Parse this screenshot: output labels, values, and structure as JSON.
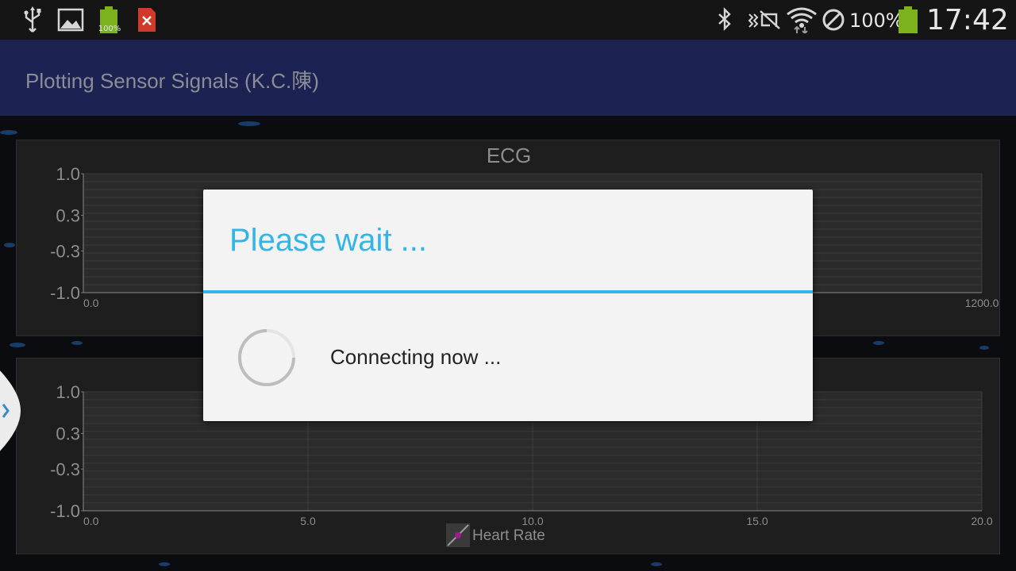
{
  "status_bar": {
    "icons_left": [
      "usb-icon",
      "image-icon",
      "battery-icon",
      "error-file-icon"
    ],
    "small_battery_label": "100%",
    "icons_right": [
      "bluetooth-icon",
      "nfc-mute-icon",
      "wifi-icon",
      "block-icon"
    ],
    "battery_percent": "100%",
    "clock": "17:42"
  },
  "action_bar": {
    "title": "Plotting Sensor Signals (K.C.陳)"
  },
  "charts": {
    "ecg": {
      "title": "ECG",
      "y_ticks": [
        "1.0",
        "0.3",
        "-0.3",
        "-1.0"
      ],
      "x_ticks": [
        "0.0",
        "1200.0"
      ]
    },
    "heart_rate": {
      "y_ticks": [
        "1.0",
        "0.3",
        "-0.3",
        "-1.0"
      ],
      "x_ticks": [
        "0.0",
        "5.0",
        "10.0",
        "15.0",
        "20.0"
      ],
      "legend_label": "Heart Rate",
      "legend_color": "#9b1d8f"
    }
  },
  "dialog": {
    "title": "Please wait ...",
    "message": "Connecting now ..."
  },
  "colors": {
    "accent": "#33b5e5",
    "action_bar": "#1c2352",
    "status_battery": "#7cb21d",
    "status_error": "#d03a2a"
  },
  "chart_data": [
    {
      "type": "line",
      "title": "ECG",
      "y_ticks": [
        1.0,
        0.3,
        -0.3,
        -1.0
      ],
      "ylim": [
        -1.0,
        1.0
      ],
      "x_ticks": [
        0.0,
        1200.0
      ],
      "xlim": [
        0.0,
        1200.0
      ],
      "grid": true,
      "series": []
    },
    {
      "type": "line",
      "title": "",
      "y_ticks": [
        1.0,
        0.3,
        -0.3,
        -1.0
      ],
      "ylim": [
        -1.0,
        1.0
      ],
      "x_ticks": [
        0.0,
        5.0,
        10.0,
        15.0,
        20.0
      ],
      "xlim": [
        0.0,
        20.0
      ],
      "grid": true,
      "legend": "bottom",
      "series": [
        {
          "name": "Heart Rate",
          "values": []
        }
      ]
    }
  ]
}
